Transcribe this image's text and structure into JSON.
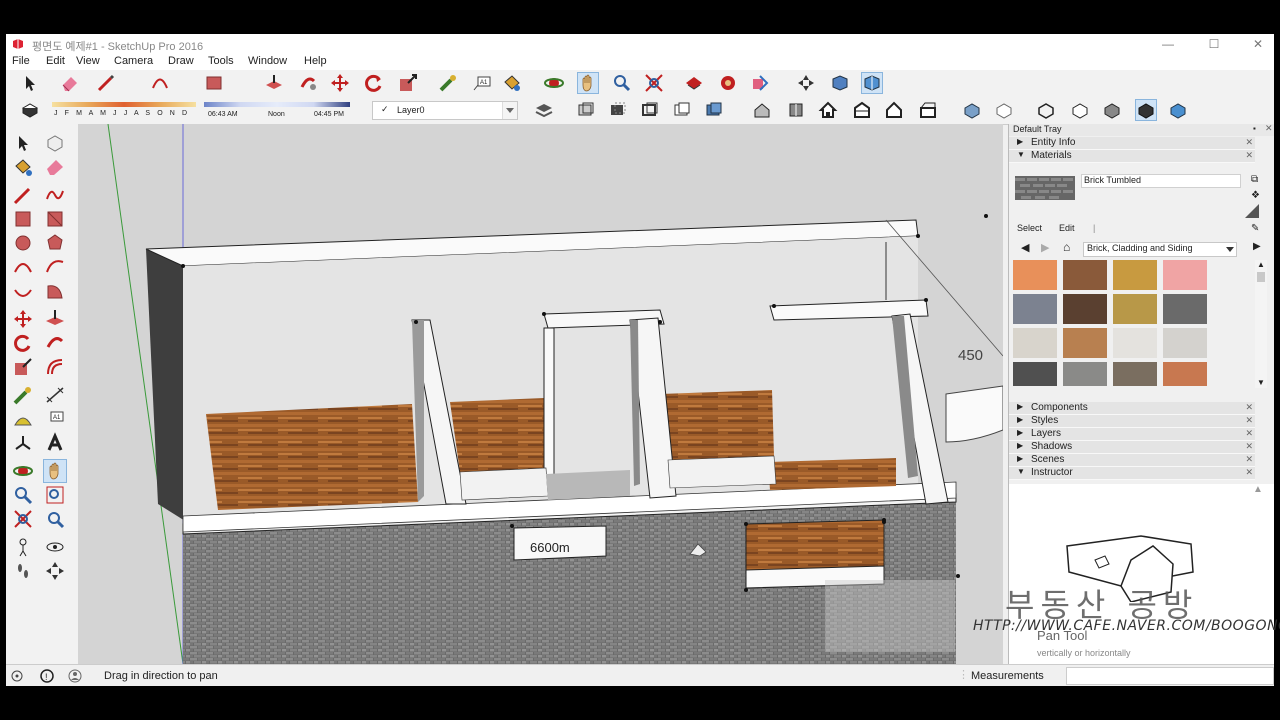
{
  "window": {
    "title": "평면도 예제#1 - SketchUp Pro 2016",
    "minimize": "—",
    "maximize": "☐",
    "close": "✕"
  },
  "menu": [
    "File",
    "Edit",
    "View",
    "Camera",
    "Draw",
    "Tools",
    "Window",
    "Help"
  ],
  "shadows": {
    "months": "J F M A M J J A S O N D",
    "time_start": "06:43 AM",
    "time_mid": "Noon",
    "time_end": "04:45 PM"
  },
  "layer": {
    "current": "Layer0",
    "check": "✓"
  },
  "viewport": {
    "dimension_right": "450",
    "dimension_window": "6600m"
  },
  "tray": {
    "title": "Default Tray",
    "panels": [
      {
        "label": "Entity Info",
        "expanded": false
      },
      {
        "label": "Materials",
        "expanded": true
      }
    ],
    "materials": {
      "current_name": "Brick Tumbled",
      "tab_select": "Select",
      "tab_edit": "Edit",
      "collection": "Brick, Cladding and Siding",
      "swatches": [
        "#e8905a",
        "#8a5a3a",
        "#c89a40",
        "#f0a4a4",
        "#7c8290",
        "#5a4030",
        "#b89848",
        "#6a6a6a",
        "#d8d4cc",
        "#b88050",
        "#e4e2de",
        "#d4d2ce",
        "#505050",
        "#8a8a88",
        "#7a6e60",
        "#c87850"
      ]
    },
    "collapsed_panels": [
      "Components",
      "Styles",
      "Layers",
      "Shadows",
      "Scenes"
    ],
    "instructor": {
      "label": "Instructor",
      "tool_name": "Pan Tool",
      "tool_desc": "vertically or horizontally"
    }
  },
  "status": {
    "message": "Drag in direction to pan",
    "measurements_label": "Measurements"
  },
  "watermark": {
    "korean": "부동산 공방",
    "url": "HTTP://WWW.CAFE.NAVER.COM/BOOGONG"
  }
}
